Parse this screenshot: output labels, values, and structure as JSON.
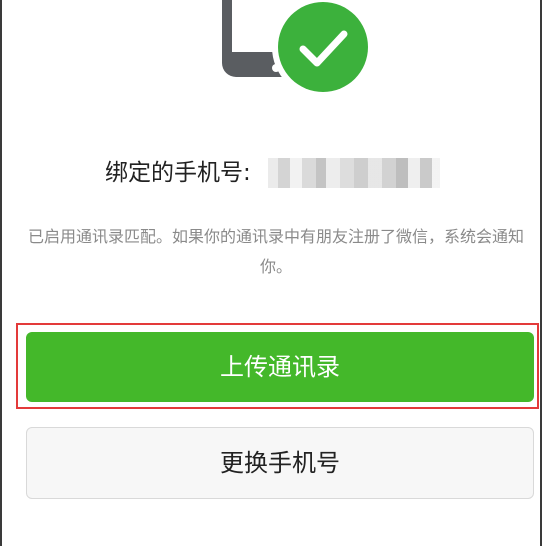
{
  "binding": {
    "label": "绑定的手机号:"
  },
  "message": {
    "text": "已启用通讯录匹配。如果你的通讯录中有朋友注册了微信，系统会通知你。"
  },
  "buttons": {
    "upload_contacts": "上传通讯录",
    "change_phone": "更换手机号"
  },
  "colors": {
    "primary_green": "#44b82a",
    "check_green": "#3cb13c",
    "highlight_red": "#e33a3a"
  },
  "icons": {
    "hero_phone": "phone-icon",
    "hero_check": "checkmark-icon"
  }
}
